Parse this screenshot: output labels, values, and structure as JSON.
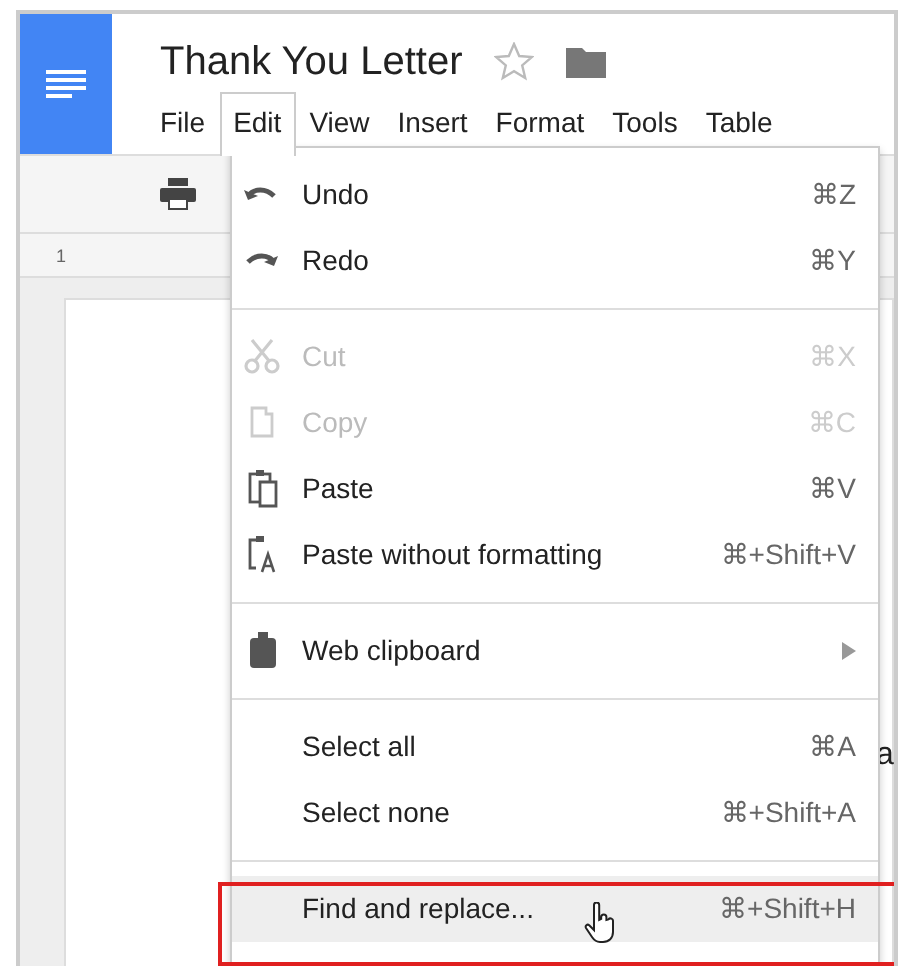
{
  "document": {
    "title": "Thank You Letter",
    "starred": false
  },
  "menus": [
    {
      "label": "File",
      "selected": false
    },
    {
      "label": "Edit",
      "selected": true
    },
    {
      "label": "View",
      "selected": false
    },
    {
      "label": "Insert",
      "selected": false
    },
    {
      "label": "Format",
      "selected": false
    },
    {
      "label": "Tools",
      "selected": false
    },
    {
      "label": "Table",
      "selected": false
    }
  ],
  "ruler_label": "1",
  "page_text_fragment": "a",
  "edit_menu": [
    {
      "kind": "item",
      "label": "Undo",
      "shortcut": "⌘Z",
      "disabled": false,
      "selected": false,
      "submenu": false,
      "outlined": false
    },
    {
      "kind": "item",
      "label": "Redo",
      "shortcut": "⌘Y",
      "disabled": false,
      "selected": false,
      "submenu": false,
      "outlined": false
    },
    {
      "kind": "separator"
    },
    {
      "kind": "item",
      "label": "Cut",
      "shortcut": "⌘X",
      "disabled": true,
      "selected": false,
      "submenu": false,
      "outlined": false
    },
    {
      "kind": "item",
      "label": "Copy",
      "shortcut": "⌘C",
      "disabled": true,
      "selected": false,
      "submenu": false,
      "outlined": false
    },
    {
      "kind": "item",
      "label": "Paste",
      "shortcut": "⌘V",
      "disabled": false,
      "selected": false,
      "submenu": false,
      "outlined": false
    },
    {
      "kind": "item",
      "label": "Paste without formatting",
      "shortcut": "⌘+Shift+V",
      "disabled": false,
      "selected": false,
      "submenu": false,
      "outlined": false
    },
    {
      "kind": "separator"
    },
    {
      "kind": "item",
      "label": "Web clipboard",
      "disabled": false,
      "selected": false,
      "submenu": true,
      "outlined": false
    },
    {
      "kind": "separator"
    },
    {
      "kind": "item",
      "label": "Select all",
      "shortcut": "⌘A",
      "disabled": false,
      "selected": false,
      "submenu": false,
      "outlined": false
    },
    {
      "kind": "item",
      "label": "Select none",
      "shortcut": "⌘+Shift+A",
      "disabled": false,
      "selected": false,
      "submenu": false,
      "outlined": false
    },
    {
      "kind": "separator"
    },
    {
      "kind": "item",
      "label": "Find and replace...",
      "shortcut": "⌘+Shift+H",
      "disabled": false,
      "selected": true,
      "submenu": false,
      "outlined": true
    }
  ]
}
